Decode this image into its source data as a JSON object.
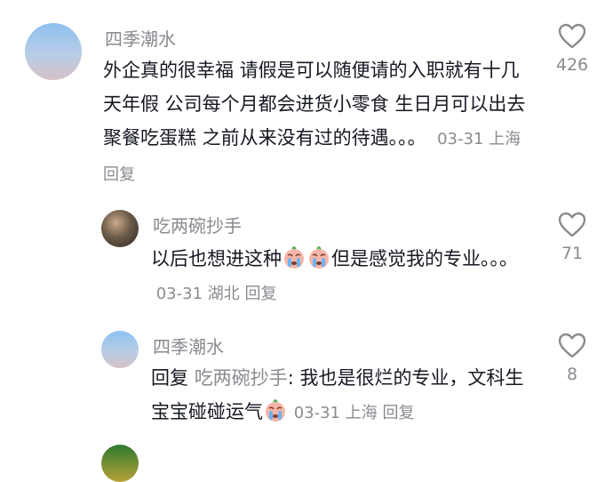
{
  "comments": [
    {
      "username": "四季潮水",
      "text": "外企真的很幸福 请假是可以随便请的入职就有十几天年假 公司每个月都会进货小零食 生日月可以出去聚餐吃蛋糕 之前从来没有过的待遇。。。",
      "date": "03-31",
      "location": "上海",
      "reply_label": "回复",
      "likes": "426",
      "avatar": "sky-avatar"
    },
    {
      "username": "吃两碗抄手",
      "text_before": "以后也想进这种",
      "emojis": [
        "crying-emoji",
        "crying-emoji"
      ],
      "text_after": "但是感觉我的专业。。。",
      "date": "03-31",
      "location": "湖北",
      "reply_label": "回复",
      "likes": "71",
      "avatar": "photo-avatar"
    },
    {
      "username": "四季潮水",
      "reply_prefix": "回复",
      "mention": "吃两碗抄手",
      "text": ": 我也是很烂的专业，文科生 宝宝碰碰运气",
      "emoji": "crying-emoji",
      "date": "03-31",
      "location": "上海",
      "reply_label": "回复",
      "likes": "8",
      "avatar": "sky-avatar"
    }
  ],
  "icons": {
    "like": "heart-outline-icon"
  },
  "colors": {
    "text": "#161823",
    "secondary": "#8a8b91",
    "background": "#ffffff"
  }
}
